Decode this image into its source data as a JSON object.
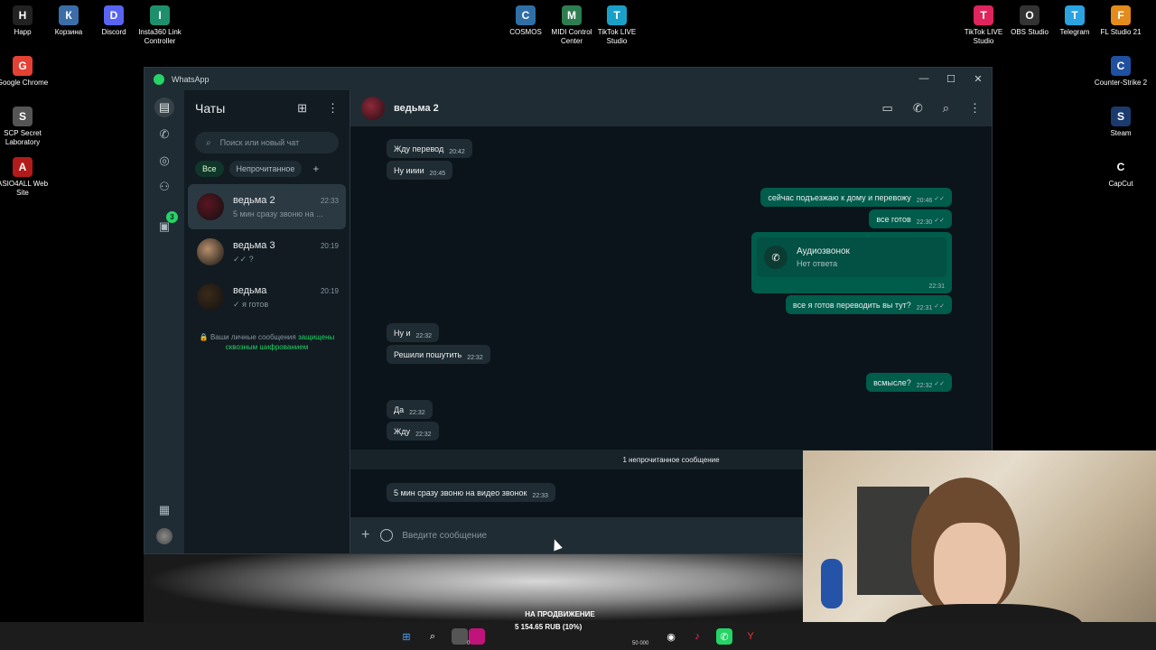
{
  "desktop": {
    "icons_top_left": [
      {
        "label": "Happ",
        "icon": "happ-icon",
        "color": "#222"
      },
      {
        "label": "Корзина",
        "icon": "recycle-bin-icon",
        "color": "#3b6ea8"
      },
      {
        "label": "Discord",
        "icon": "discord-icon",
        "color": "#5865f2"
      },
      {
        "label": "Insta360 Link Controller",
        "icon": "insta360-icon",
        "color": "#1e8f6b"
      }
    ],
    "icons_left_column": [
      {
        "label": "Google Chrome",
        "icon": "chrome-icon",
        "color": "#e44134"
      },
      {
        "label": "SCP Secret Laboratory",
        "icon": "scp-icon",
        "color": "#555"
      },
      {
        "label": "ASIO4ALL Web Site",
        "icon": "asio-icon",
        "color": "#b31b1b"
      }
    ],
    "icons_top_center": [
      {
        "label": "COSMOS",
        "icon": "cosmos-icon",
        "color": "#2f6fa6"
      },
      {
        "label": "MIDI Control Center",
        "icon": "midi-icon",
        "color": "#2e7d4f"
      },
      {
        "label": "TikTok LIVE Studio",
        "icon": "tiktok-live-icon",
        "color": "#1aa0c8"
      }
    ],
    "icons_top_right": [
      {
        "label": "TikTok LIVE Studio",
        "icon": "tiktok-live-icon",
        "color": "#e0245e"
      },
      {
        "label": "OBS Studio",
        "icon": "obs-icon",
        "color": "#333"
      },
      {
        "label": "Telegram",
        "icon": "telegram-icon",
        "color": "#2aa3e0"
      },
      {
        "label": "FL Studio 21",
        "icon": "fl-studio-icon",
        "color": "#e38b1b"
      }
    ],
    "icons_right_column": [
      {
        "label": "Counter-Strike 2",
        "icon": "cs2-icon",
        "color": "#2050a0"
      },
      {
        "label": "Steam",
        "icon": "steam-icon",
        "color": "#1b3b6f"
      },
      {
        "label": "CapCut",
        "icon": "capcut-icon",
        "color": "#000"
      }
    ]
  },
  "window": {
    "title": "WhatsApp",
    "controls": {
      "minimize": "—",
      "maximize": "☐",
      "close": "✕"
    }
  },
  "rail": {
    "updates_badge": "3"
  },
  "chatlist": {
    "title": "Чаты",
    "search_placeholder": "Поиск или новый чат",
    "filters": [
      "Все",
      "Непрочитанное"
    ],
    "chats": [
      {
        "name": "ведьма 2",
        "time": "22:33",
        "preview": "5 мин сразу звоню на ...",
        "avatar": "#5a1520"
      },
      {
        "name": "ведьма 3",
        "time": "20:19",
        "preview": "✓✓ ?",
        "avatar": "#b78f6c"
      },
      {
        "name": "ведьма",
        "time": "20:19",
        "preview": "✓ я готов",
        "avatar": "#3b2a1a"
      }
    ],
    "e2e_prefix": "🔒 Ваши личные сообщения ",
    "e2e_link": "защищены сквозным шифрованием"
  },
  "conversation": {
    "name": "ведьма 2",
    "messages": [
      {
        "dir": "in",
        "text": "Жду перевод",
        "time": "20:42"
      },
      {
        "dir": "in",
        "text": "Ну ииии",
        "time": "20:45"
      },
      {
        "dir": "out",
        "text": "сейчас подъезжаю к дому и перевожу",
        "time": "20:46"
      },
      {
        "dir": "out",
        "text": "все готов",
        "time": "22:30"
      },
      {
        "dir": "out",
        "text": "все я готов переводить вы тут?",
        "time": "22:31"
      },
      {
        "dir": "in",
        "text": "Ну и",
        "time": "22:32"
      },
      {
        "dir": "in",
        "text": "Решили пошутить",
        "time": "22:32"
      },
      {
        "dir": "out",
        "text": "всмысле?",
        "time": "22:32"
      },
      {
        "dir": "in",
        "text": "Да",
        "time": "22:32"
      },
      {
        "dir": "in",
        "text": "Жду",
        "time": "22:32"
      },
      {
        "dir": "in",
        "text": "5 мин сразу звоню на видео звонок",
        "time": "22:33"
      }
    ],
    "call": {
      "title": "Аудиозвонок",
      "subtitle": "Нет ответа",
      "time": "22:31"
    },
    "unread_divider": "1 непрочитанное сообщение",
    "composer_placeholder": "Введите сообщение"
  },
  "overlay": {
    "promo_text": "НА ПРОДВИЖЕНИЕ",
    "donation_text": "5 154.65 RUB (10%)",
    "num_left": "0",
    "num_right": "50 000"
  }
}
